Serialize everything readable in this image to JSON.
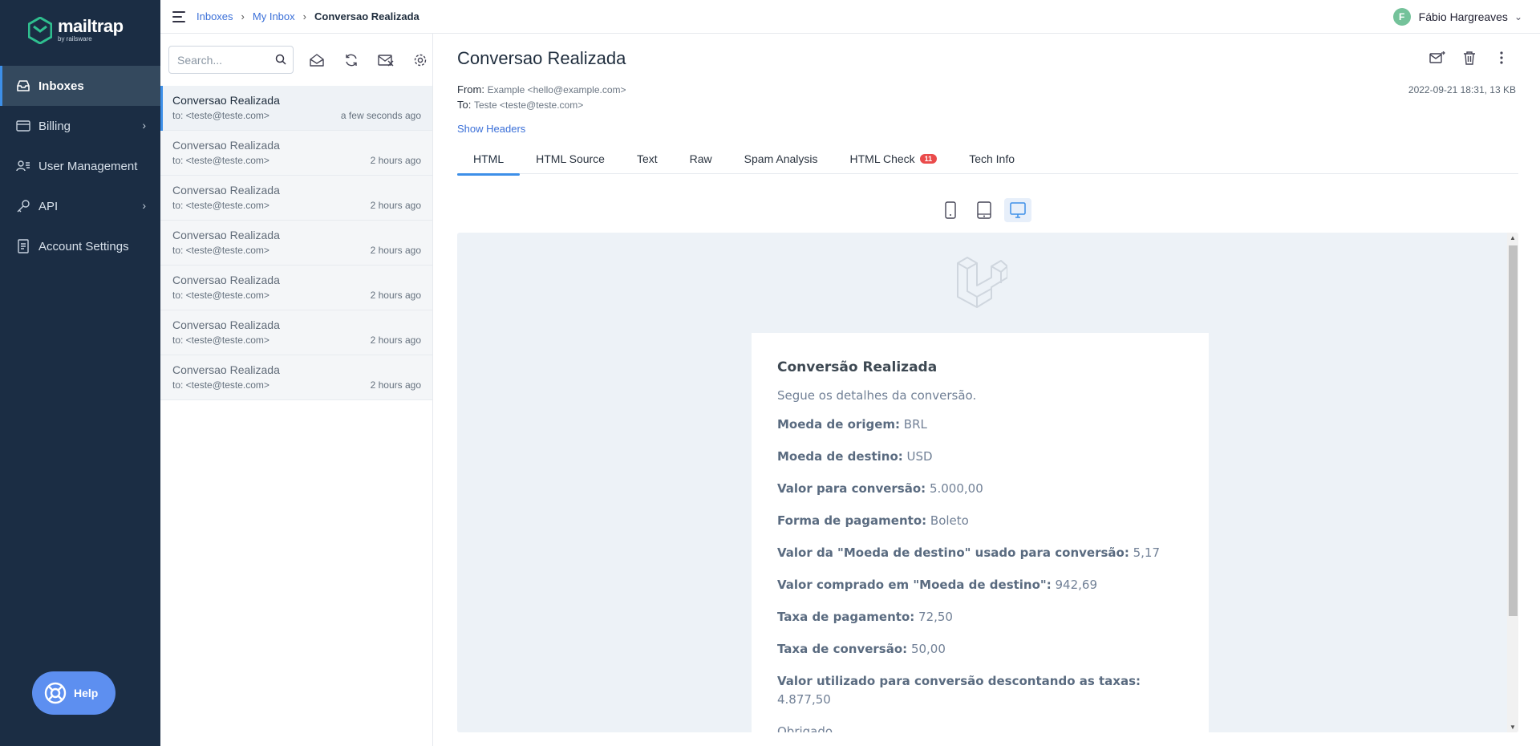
{
  "brand": {
    "name": "mailtrap",
    "tagline": "by railsware"
  },
  "nav": {
    "items": [
      {
        "label": "Inboxes",
        "icon": "inbox-icon",
        "active": true
      },
      {
        "label": "Billing",
        "icon": "card-icon",
        "chevron": "›"
      },
      {
        "label": "User Management",
        "icon": "users-icon"
      },
      {
        "label": "API",
        "icon": "key-icon",
        "chevron": "›"
      },
      {
        "label": "Account Settings",
        "icon": "document-icon"
      }
    ]
  },
  "help": {
    "label": "Help"
  },
  "breadcrumb": {
    "items": [
      "Inboxes",
      "My Inbox",
      "Conversao Realizada"
    ],
    "sep": "›"
  },
  "user": {
    "initial": "F",
    "name": "Fábio Hargreaves",
    "chevron": "⌄"
  },
  "search": {
    "placeholder": "Search..."
  },
  "messages": [
    {
      "subject": "Conversao Realizada",
      "to": "to: <teste@teste.com>",
      "time": "a few seconds ago",
      "selected": true
    },
    {
      "subject": "Conversao Realizada",
      "to": "to: <teste@teste.com>",
      "time": "2 hours ago"
    },
    {
      "subject": "Conversao Realizada",
      "to": "to: <teste@teste.com>",
      "time": "2 hours ago"
    },
    {
      "subject": "Conversao Realizada",
      "to": "to: <teste@teste.com>",
      "time": "2 hours ago"
    },
    {
      "subject": "Conversao Realizada",
      "to": "to: <teste@teste.com>",
      "time": "2 hours ago"
    },
    {
      "subject": "Conversao Realizada",
      "to": "to: <teste@teste.com>",
      "time": "2 hours ago"
    },
    {
      "subject": "Conversao Realizada",
      "to": "to: <teste@teste.com>",
      "time": "2 hours ago"
    }
  ],
  "email": {
    "title": "Conversao Realizada",
    "from_label": "From:",
    "from": "Example <hello@example.com>",
    "to_label": "To:",
    "to": "Teste <teste@teste.com>",
    "date": "2022-09-21 18:31, 13 KB",
    "show_headers": "Show Headers"
  },
  "tabs": [
    {
      "label": "HTML",
      "active": true
    },
    {
      "label": "HTML Source"
    },
    {
      "label": "Text"
    },
    {
      "label": "Raw"
    },
    {
      "label": "Spam Analysis"
    },
    {
      "label": "HTML Check",
      "badge": "11"
    },
    {
      "label": "Tech Info"
    }
  ],
  "body": {
    "heading": "Conversão Realizada",
    "intro": "Segue os detalhes da conversão.",
    "fields": [
      {
        "label": "Moeda de origem:",
        "value": "BRL"
      },
      {
        "label": "Moeda de destino:",
        "value": "USD"
      },
      {
        "label": "Valor para conversão:",
        "value": "5.000,00"
      },
      {
        "label": "Forma de pagamento:",
        "value": "Boleto"
      },
      {
        "label": "Valor da \"Moeda de destino\" usado para conversão:",
        "value": "5,17"
      },
      {
        "label": "Valor comprado em \"Moeda de destino\":",
        "value": "942,69"
      },
      {
        "label": "Taxa de pagamento:",
        "value": "72,50"
      },
      {
        "label": "Taxa de conversão:",
        "value": "50,00"
      },
      {
        "label": "Valor utilizado para conversão descontando as taxas:",
        "value": "4.877,50"
      }
    ],
    "closing": "Obrigado,"
  },
  "colors": {
    "sidebar": "#1b2d44",
    "accent": "#3d8fe8",
    "link": "#3a6fd8",
    "badge": "#ea4b4b"
  }
}
